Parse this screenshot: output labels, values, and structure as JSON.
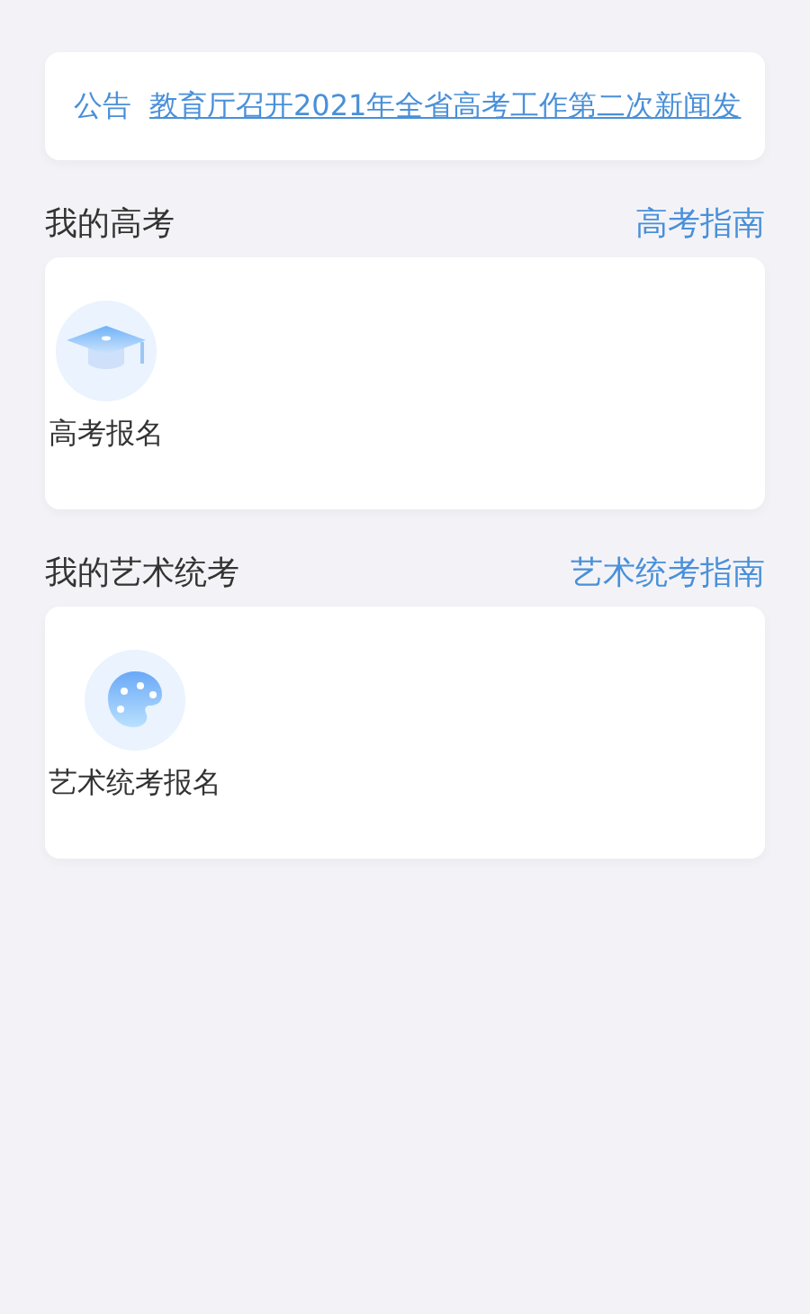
{
  "notice": {
    "tag": "公告",
    "text": "教育厅召开2021年全省高考工作第二次新闻发"
  },
  "sections": [
    {
      "title": "我的高考",
      "link": "高考指南",
      "items": [
        {
          "label": "高考报名",
          "kind": "cap"
        }
      ]
    },
    {
      "title": "我的艺术统考",
      "link": "艺术统考指南",
      "items": [
        {
          "label": "艺术统考报名",
          "kind": "palette"
        }
      ]
    }
  ]
}
